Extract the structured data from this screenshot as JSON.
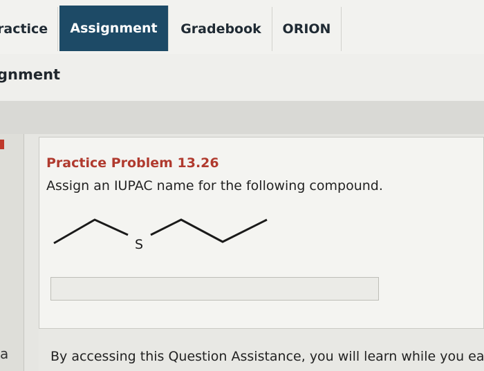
{
  "nav": {
    "tabs": [
      {
        "label": "ractice"
      },
      {
        "label": "Assignment"
      },
      {
        "label": "Gradebook"
      },
      {
        "label": "ORION"
      }
    ],
    "active_tab": "Assignment",
    "active_color": "#1d4a66"
  },
  "page": {
    "heading": "gnment"
  },
  "gutter": {
    "letter": "a"
  },
  "problem": {
    "title": "Practice Problem 13.26",
    "title_color": "#b03a2e",
    "question": "Assign an IUPAC name for the following compound.",
    "molecule_atom_label": "S",
    "answer_value": ""
  },
  "footer": {
    "text": "By accessing this Question Assistance, you will learn while you ea"
  }
}
